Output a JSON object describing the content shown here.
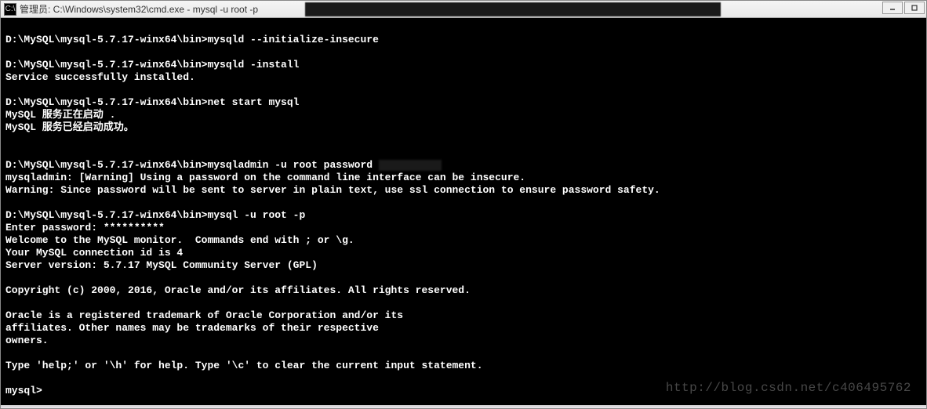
{
  "window": {
    "icon_label": "C:\\",
    "title": "管理员: C:\\Windows\\system32\\cmd.exe - mysql  -u root -p",
    "redacted_overlay": " ",
    "controls": {
      "minimize": "minimize",
      "maximize": "maximize"
    }
  },
  "terminal": {
    "lines": [
      "",
      "D:\\MySQL\\mysql-5.7.17-winx64\\bin>mysqld --initialize-insecure",
      "",
      "D:\\MySQL\\mysql-5.7.17-winx64\\bin>mysqld -install",
      "Service successfully installed.",
      "",
      "D:\\MySQL\\mysql-5.7.17-winx64\\bin>net start mysql",
      "MySQL 服务正在启动 .",
      "MySQL 服务已经启动成功。",
      "",
      "",
      "D:\\MySQL\\mysql-5.7.17-winx64\\bin>mysqladmin -u root password ",
      "mysqladmin: [Warning] Using a password on the command line interface can be insecure.",
      "Warning: Since password will be sent to server in plain text, use ssl connection to ensure password safety.",
      "",
      "D:\\MySQL\\mysql-5.7.17-winx64\\bin>mysql -u root -p",
      "Enter password: **********",
      "Welcome to the MySQL monitor.  Commands end with ; or \\g.",
      "Your MySQL connection id is 4",
      "Server version: 5.7.17 MySQL Community Server (GPL)",
      "",
      "Copyright (c) 2000, 2016, Oracle and/or its affiliates. All rights reserved.",
      "",
      "Oracle is a registered trademark of Oracle Corporation and/or its",
      "affiliates. Other names may be trademarks of their respective",
      "owners.",
      "",
      "Type 'help;' or '\\h' for help. Type '\\c' to clear the current input statement.",
      "",
      "mysql>"
    ],
    "password_redact_line_index": 11
  },
  "watermark": "http://blog.csdn.net/c406495762"
}
